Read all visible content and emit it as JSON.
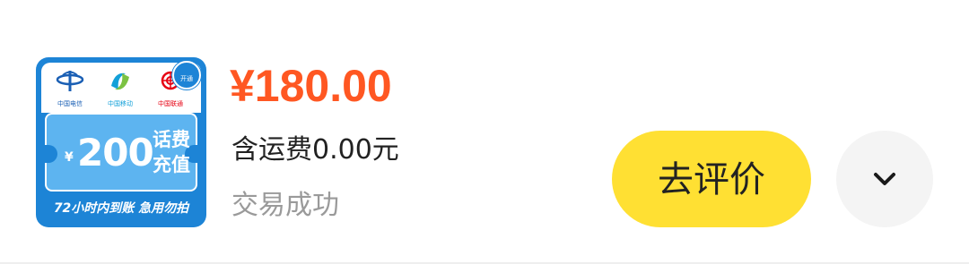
{
  "order": {
    "thumbnail": {
      "logos": [
        {
          "icon": "china-telecom-logo-icon",
          "text": "中国电信"
        },
        {
          "icon": "china-mobile-logo-icon",
          "text": "中国移动"
        },
        {
          "icon": "china-unicom-logo-icon",
          "text": "中国联通"
        }
      ],
      "badge": "开通",
      "currency": "¥",
      "amount": "200",
      "kind": "话费充值",
      "caption": "72小时内到账 急用勿拍",
      "colors": {
        "background": "#1d84d6",
        "voucher": "#5db4f0"
      }
    },
    "price": "¥180.00",
    "shipping": "含运费0.00元",
    "status": "交易成功",
    "review_button": "去评价",
    "more_icon": "chevron-down-icon",
    "colors": {
      "price": "#ff5722",
      "review_button": "#ffe033",
      "more_button": "#f4f4f4"
    }
  }
}
